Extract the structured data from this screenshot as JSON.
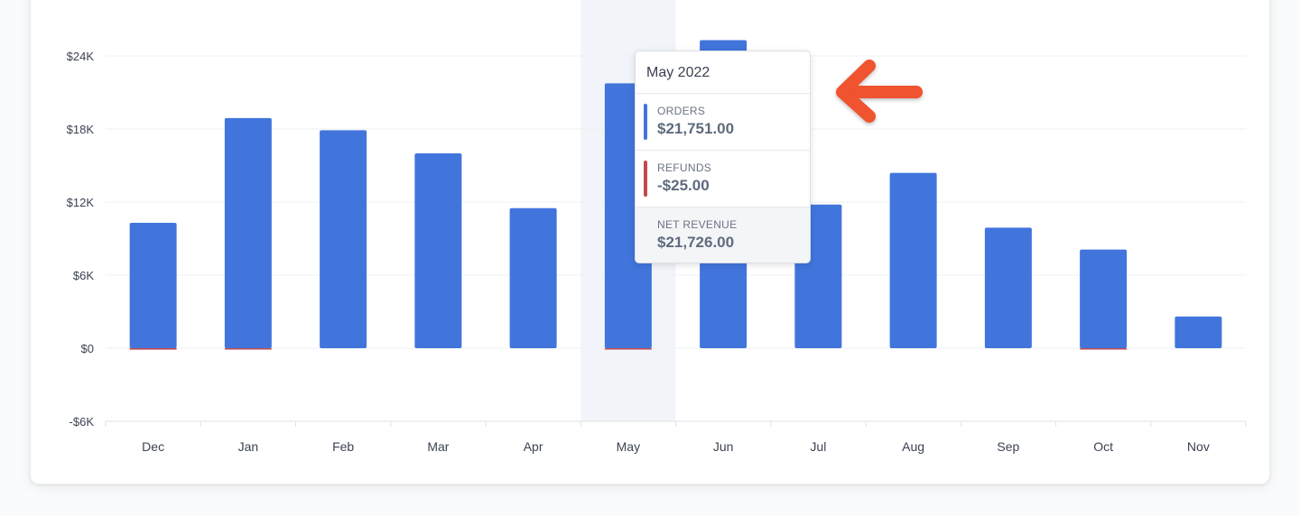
{
  "chart_data": {
    "type": "bar",
    "categories": [
      "Dec",
      "Jan",
      "Feb",
      "Mar",
      "Apr",
      "May",
      "Jun",
      "Jul",
      "Aug",
      "Sep",
      "Oct",
      "Nov"
    ],
    "series": [
      {
        "name": "Orders",
        "values": [
          10300,
          18900,
          17900,
          16000,
          11500,
          21751,
          25300,
          11800,
          14400,
          9900,
          8100,
          2600
        ]
      },
      {
        "name": "Refunds",
        "values": [
          -120,
          -30,
          0,
          0,
          0,
          -25,
          0,
          0,
          0,
          0,
          -40,
          0
        ]
      }
    ],
    "ylim": [
      -6000,
      24000
    ],
    "yticks": [
      "$24K",
      "$18K",
      "$12K",
      "$6K",
      "$0",
      "-$6K"
    ],
    "ytick_values": [
      24000,
      18000,
      12000,
      6000,
      0,
      -6000
    ],
    "highlighted_category": "May",
    "colors": {
      "orders": "#4175dc",
      "refunds": "#c4484d",
      "highlight": "#f1f5fa",
      "arrow": "#f0532f"
    },
    "grid": true
  },
  "tooltip": {
    "title": "May 2022",
    "orders_label": "ORDERS",
    "orders_value": "$21,751.00",
    "refunds_label": "REFUNDS",
    "refunds_value": "-$25.00",
    "net_label": "NET REVENUE",
    "net_value": "$21,726.00"
  }
}
